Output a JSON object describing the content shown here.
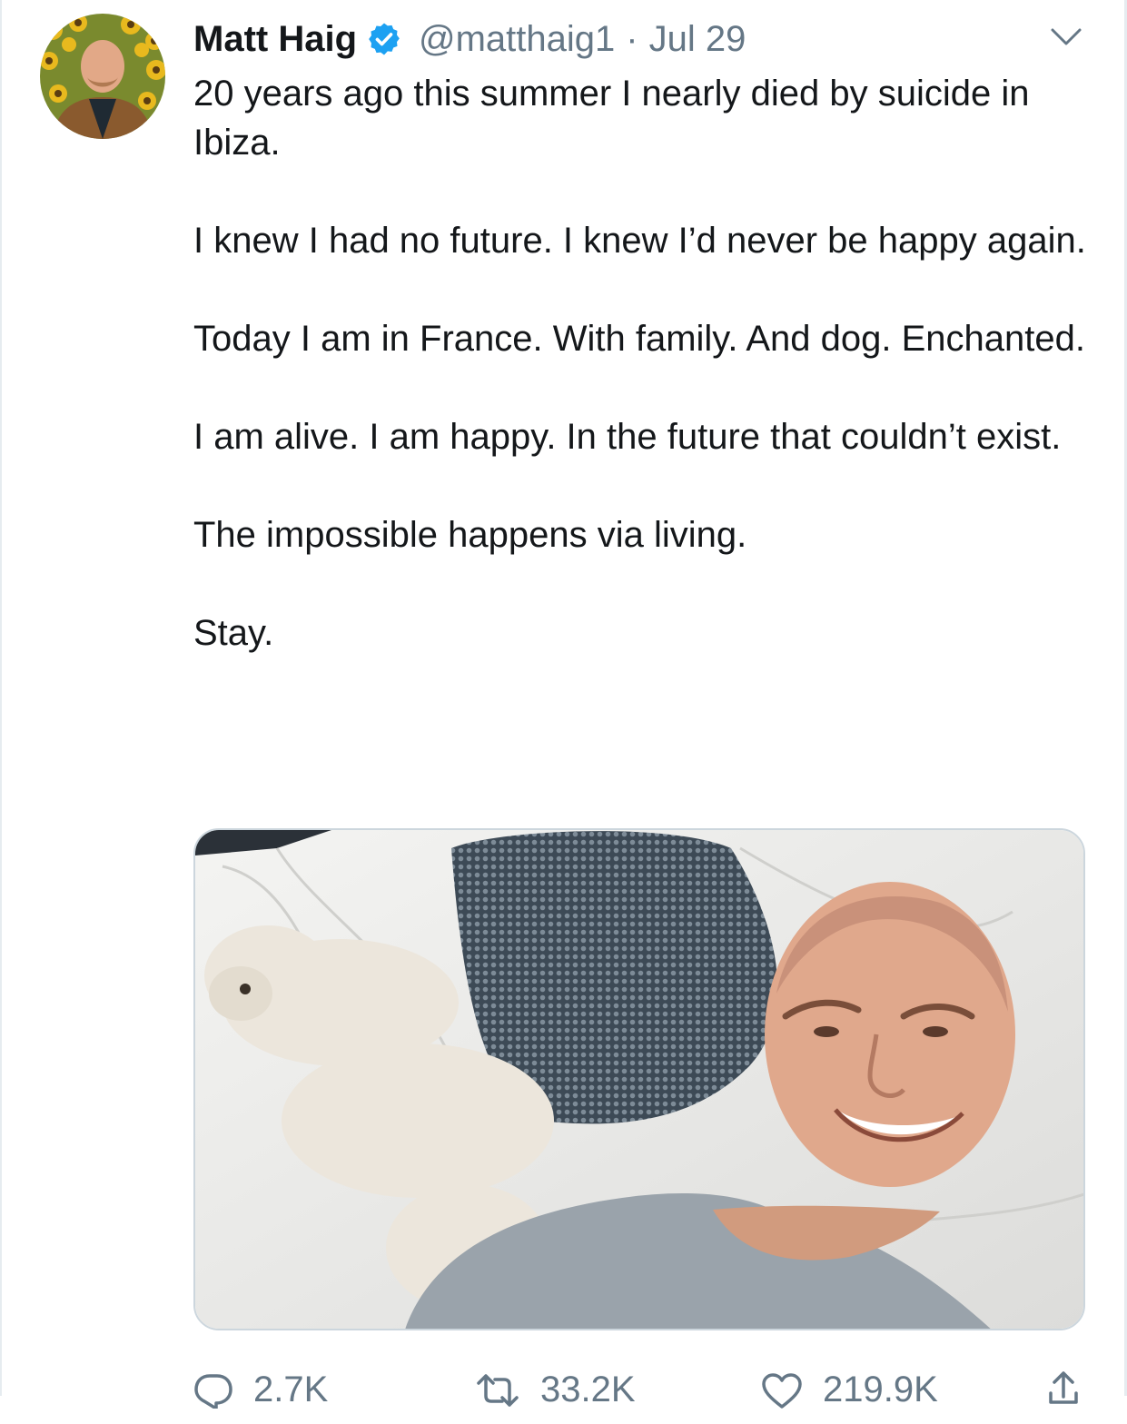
{
  "tweet": {
    "author_name": "Matt Haig",
    "handle": "@matthaig1",
    "separator": "·",
    "date": "Jul 29",
    "paragraphs": [
      "20 years ago this summer I nearly died by suicide in Ibiza.",
      "I knew I had no future. I knew I’d never be happy again.",
      "Today I am in France. With family. And dog. Enchanted.",
      "I am alive. I am happy. In the future that couldn’t exist.",
      "The impossible happens via living.",
      "Stay."
    ],
    "stats": {
      "replies": "2.7K",
      "retweets": "33.2K",
      "likes": "219.9K"
    }
  },
  "icons": {
    "verified": "verified-badge-icon",
    "menu": "chevron-down-icon",
    "reply": "reply-icon",
    "retweet": "retweet-icon",
    "like": "heart-icon",
    "share": "share-icon"
  },
  "colors": {
    "text": "#14171a",
    "secondary": "#657786",
    "verified": "#1da1f2",
    "border": "#e6ecf0"
  }
}
